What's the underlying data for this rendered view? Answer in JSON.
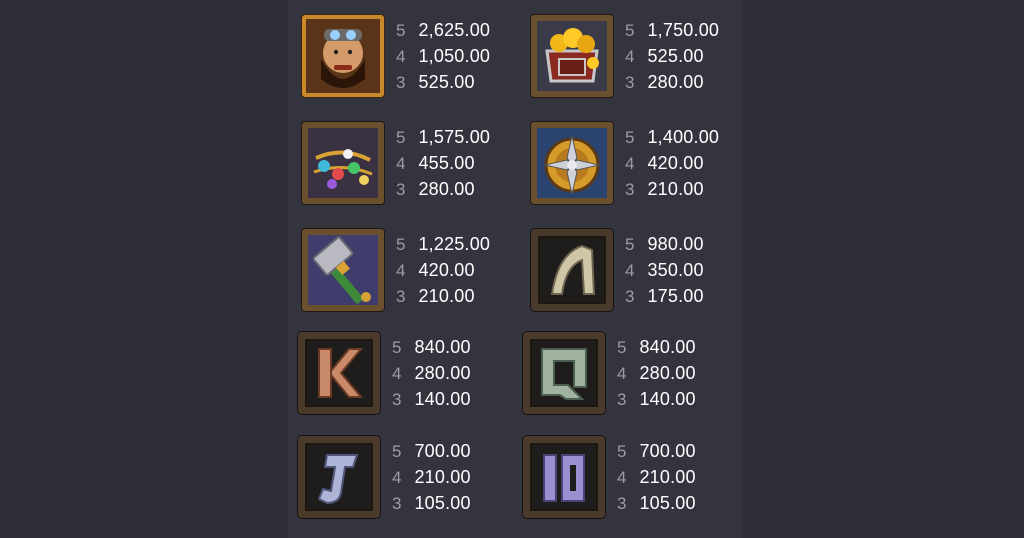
{
  "paytable": [
    {
      "symbol": "dwarf",
      "icon": "dwarf-icon",
      "pays": [
        {
          "count": "5",
          "value": "2,625.00"
        },
        {
          "count": "4",
          "value": "1,050.00"
        },
        {
          "count": "3",
          "value": "525.00"
        }
      ]
    },
    {
      "symbol": "gold-chest",
      "icon": "gold-chest-icon",
      "pays": [
        {
          "count": "5",
          "value": "1,750.00"
        },
        {
          "count": "4",
          "value": "525.00"
        },
        {
          "count": "3",
          "value": "280.00"
        }
      ]
    },
    {
      "symbol": "gems",
      "icon": "gems-icon",
      "pays": [
        {
          "count": "5",
          "value": "1,575.00"
        },
        {
          "count": "4",
          "value": "455.00"
        },
        {
          "count": "3",
          "value": "280.00"
        }
      ]
    },
    {
      "symbol": "shield",
      "icon": "shield-icon",
      "pays": [
        {
          "count": "5",
          "value": "1,400.00"
        },
        {
          "count": "4",
          "value": "420.00"
        },
        {
          "count": "3",
          "value": "210.00"
        }
      ]
    },
    {
      "symbol": "hammer",
      "icon": "hammer-icon",
      "pays": [
        {
          "count": "5",
          "value": "1,225.00"
        },
        {
          "count": "4",
          "value": "420.00"
        },
        {
          "count": "3",
          "value": "210.00"
        }
      ]
    },
    {
      "symbol": "A",
      "icon": "rune-a-icon",
      "pays": [
        {
          "count": "5",
          "value": "980.00"
        },
        {
          "count": "4",
          "value": "350.00"
        },
        {
          "count": "3",
          "value": "175.00"
        }
      ]
    },
    {
      "symbol": "K",
      "icon": "rune-k-icon",
      "pays": [
        {
          "count": "5",
          "value": "840.00"
        },
        {
          "count": "4",
          "value": "280.00"
        },
        {
          "count": "3",
          "value": "140.00"
        }
      ]
    },
    {
      "symbol": "Q",
      "icon": "rune-q-icon",
      "pays": [
        {
          "count": "5",
          "value": "840.00"
        },
        {
          "count": "4",
          "value": "280.00"
        },
        {
          "count": "3",
          "value": "140.00"
        }
      ]
    },
    {
      "symbol": "J",
      "icon": "rune-j-icon",
      "pays": [
        {
          "count": "5",
          "value": "700.00"
        },
        {
          "count": "4",
          "value": "210.00"
        },
        {
          "count": "3",
          "value": "105.00"
        }
      ]
    },
    {
      "symbol": "10",
      "icon": "rune-10-icon",
      "pays": [
        {
          "count": "5",
          "value": "700.00"
        },
        {
          "count": "4",
          "value": "210.00"
        },
        {
          "count": "3",
          "value": "105.00"
        }
      ]
    }
  ],
  "colors": {
    "background": "#2e2e38",
    "panel": "#34343f",
    "value_text": "#ffffff",
    "count_text": "#9c9ca6",
    "gold": "#c9892a"
  }
}
